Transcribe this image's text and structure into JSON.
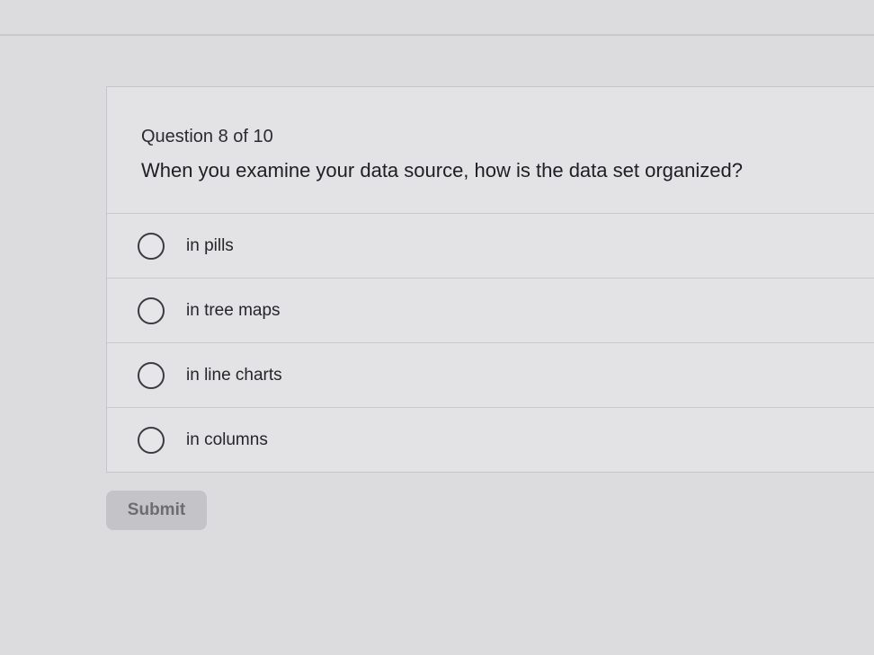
{
  "quiz": {
    "counter": "Question 8 of 10",
    "question": "When you examine your data source, how is the data set organized?",
    "options": [
      {
        "label": "in pills"
      },
      {
        "label": "in tree maps"
      },
      {
        "label": "in line charts"
      },
      {
        "label": "in columns"
      }
    ],
    "submit_label": "Submit"
  },
  "colors": {
    "background": "#dcdcdf",
    "card": "#e3e3e6",
    "submit_button_disabled": "#c4c4c8",
    "submit_text_disabled": "#6c6c72"
  },
  "icons": {
    "option_radio": "radio-unchecked-icon"
  }
}
